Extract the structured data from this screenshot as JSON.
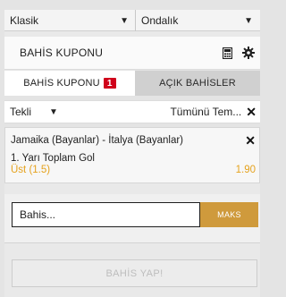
{
  "selects": {
    "bet_style": "Klasik",
    "odds_format": "Ondalık"
  },
  "coupon": {
    "title": "BAHİS KUPONU",
    "icons": [
      "calculator-icon",
      "gear-icon"
    ]
  },
  "tabs": {
    "coupon_label": "BAHİS KUPONU",
    "coupon_count": "1",
    "open_bets_label": "AÇIK BAHİSLER"
  },
  "bet_type": {
    "selected": "Tekli",
    "clear_all_label": "Tümünü Tem..."
  },
  "selection": {
    "event": "Jamaika (Bayanlar) - İtalya (Bayanlar)",
    "market": "1. Yarı Toplam Gol",
    "outcome": "Üst (1.5)",
    "odds": "1.90"
  },
  "stake": {
    "placeholder": "Bahis...",
    "max_label": "MAKS"
  },
  "submit": {
    "label": "BAHİS YAP!"
  },
  "colors": {
    "accent_gold": "#cf9a3c",
    "odds_orange": "#e5a21d",
    "badge_red": "#d0021b"
  }
}
